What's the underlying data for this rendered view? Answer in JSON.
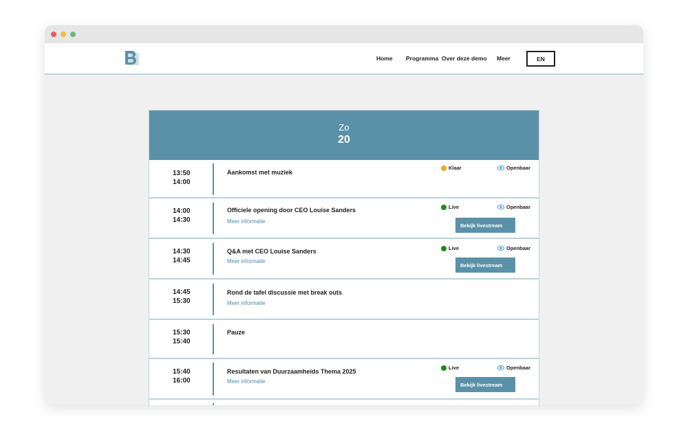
{
  "nav": {
    "links": [
      "Home",
      "Programma",
      "Over deze demo",
      "Meer"
    ],
    "lang": "EN"
  },
  "day": {
    "name": "Zo",
    "number": "20"
  },
  "colors": {
    "accent": "#5a91a8",
    "live": "#1e8a1e",
    "done": "#f5a623",
    "divider": "#b8d3dc"
  },
  "sessions": [
    {
      "start": "13:50",
      "end": "14:00",
      "title": "Aankomst met muziek",
      "more": "",
      "status": "Klaar",
      "access": "Openbaar",
      "button": ""
    },
    {
      "start": "14:00",
      "end": "14:30",
      "title": "Officiele opening door CEO Louise Sanders",
      "more": "Meer informatie",
      "status": "Live",
      "access": "Openbaar",
      "button": "Bekijk livestream"
    },
    {
      "start": "14:30",
      "end": "14:45",
      "title": "Q&A met CEO Louise Sanders",
      "more": "Meer informatie",
      "status": "Live",
      "access": "Openbaar",
      "button": "Bekijk livestream"
    },
    {
      "start": "14:45",
      "end": "15:30",
      "title": "Rond de tafel discussie met break outs",
      "more": "Meer informatie",
      "status": "",
      "access": "",
      "button": ""
    },
    {
      "start": "15:30",
      "end": "15:40",
      "title": "Pauze",
      "more": "",
      "status": "",
      "access": "",
      "button": ""
    },
    {
      "start": "15:40",
      "end": "16:00",
      "title": "Resultaten van Duurzaamheids Thema 2025",
      "more": "Meer informatie",
      "status": "Live",
      "access": "Openbaar",
      "button": "Bekijk livestream"
    }
  ]
}
